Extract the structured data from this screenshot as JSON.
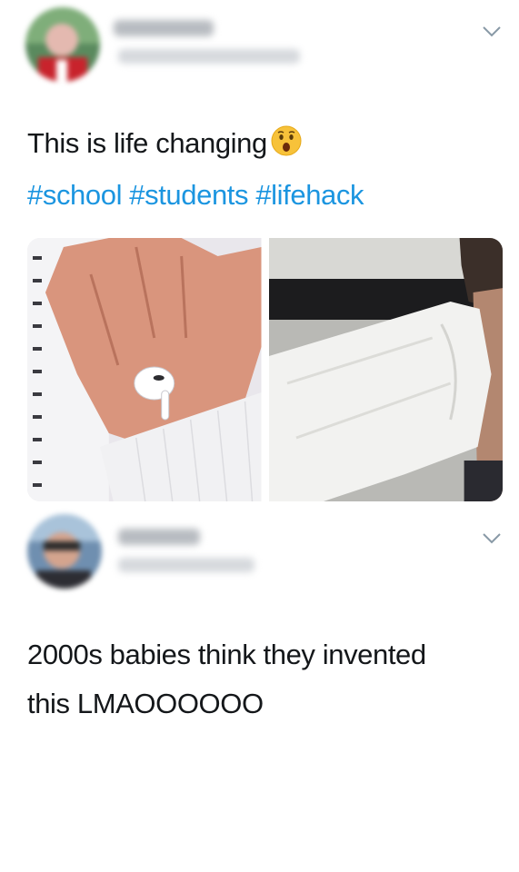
{
  "tweet1": {
    "text": "This is life changing",
    "emoji": "astonished-face",
    "hashtags": [
      "#school",
      "#students",
      "#lifehack"
    ],
    "media": [
      {
        "description_name": "hand-with-earbud-photo"
      },
      {
        "description_name": "sleeve-over-earbud-photo"
      }
    ]
  },
  "tweet2": {
    "text_line1": "2000s babies think they invented",
    "text_line2": "this LMAOOOOOO"
  },
  "colors": {
    "hashtag": "#1b95e0",
    "text": "#14171a",
    "chevron": "#8899a6"
  }
}
